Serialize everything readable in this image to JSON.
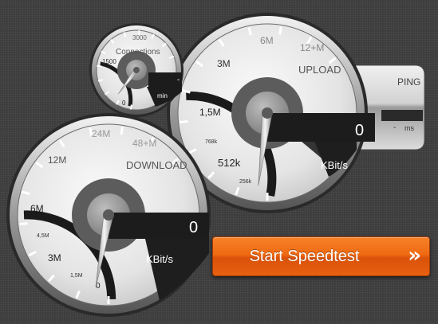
{
  "connections": {
    "label": "Connections",
    "scale": [
      "0",
      "1500",
      "3000"
    ],
    "unit": "min",
    "value": "-"
  },
  "upload": {
    "label": "UPLOAD",
    "scale": [
      "256k",
      "512k",
      "768k",
      "1,5M",
      "3M",
      "6M",
      "12+M"
    ],
    "value": "0",
    "unit": "KBit/s"
  },
  "download": {
    "label": "DOWNLOAD",
    "scale": [
      "0",
      "1,5M",
      "3M",
      "4,5M",
      "6M",
      "12M",
      "24M",
      "48+M"
    ],
    "value": "0",
    "unit": "KBit/s"
  },
  "ping": {
    "label": "PING",
    "value": "-",
    "unit": "ms"
  },
  "start_button": {
    "label": "Start Speedtest",
    "icon": "double-chevron-right-icon"
  },
  "colors": {
    "accent": "#f07018",
    "background": "#3a3a3a",
    "readout": "#1c1c1c"
  }
}
